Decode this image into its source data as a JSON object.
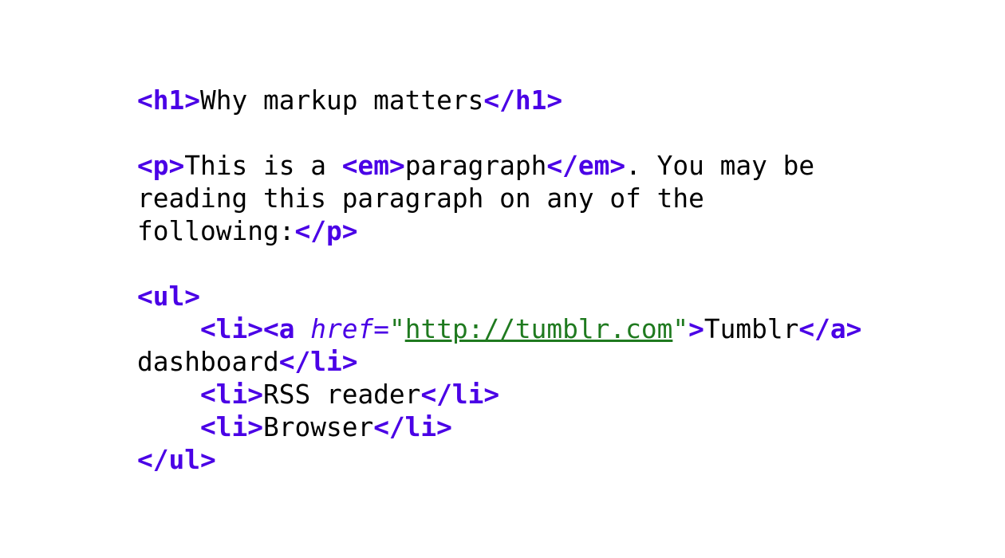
{
  "code": {
    "h1_open": "<h1>",
    "h1_text": "Why markup matters",
    "h1_close": "</h1>",
    "p_open": "<p>",
    "p_text1": "This is a ",
    "em_open": "<em>",
    "em_text": "paragraph",
    "em_close": "</em>",
    "p_text2": ". You may be",
    "p_line2": "reading this paragraph on any of the",
    "p_line3": "following:",
    "p_close": "</p>",
    "ul_open": "<ul>",
    "indent": "    ",
    "li_open": "<li>",
    "a_open_start": "<a",
    "space": " ",
    "href_attr": "href",
    "equals": "=",
    "quote": "\"",
    "href_value": "http://tumblr.com",
    "a_open_end": ">",
    "link_text": "Tumblr",
    "a_close": "</a>",
    "li1_cont": "dashboard",
    "li_close": "</li>",
    "li2_text": "RSS reader",
    "li3_text": "Browser",
    "ul_close": "</ul>"
  },
  "colors": {
    "tag": "#4a00e6",
    "text": "#000000",
    "string": "#1f7a1f",
    "background": "#ffffff"
  }
}
